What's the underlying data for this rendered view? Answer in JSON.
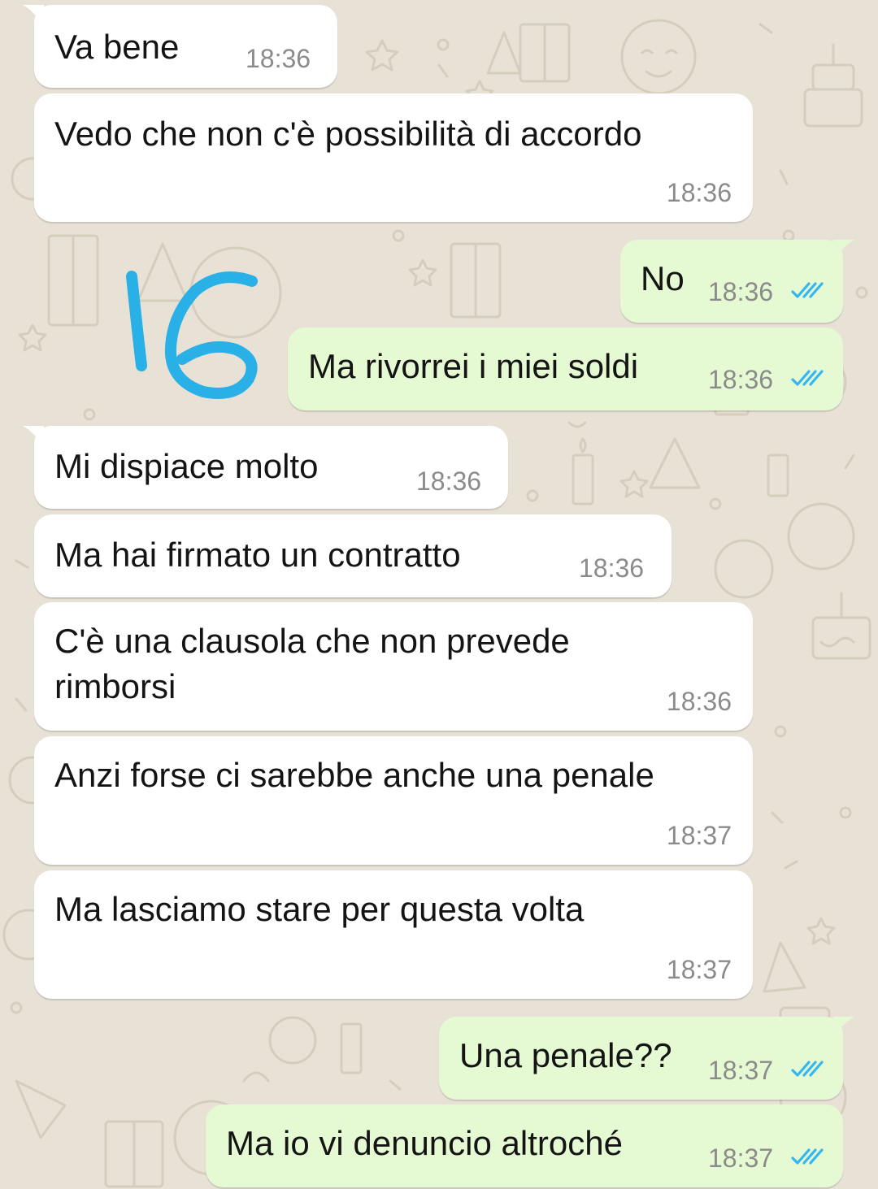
{
  "colors": {
    "wallpaper": "#e8e1d6",
    "incoming_bubble": "#ffffff",
    "outgoing_bubble": "#e5f9d3",
    "read_ticks": "#34b7f1",
    "annotation_ink": "#29b0e6"
  },
  "annotation": {
    "text": "16"
  },
  "messages": [
    {
      "direction": "incoming",
      "text": "Va bene",
      "time": "18:36"
    },
    {
      "direction": "incoming",
      "text": "Vedo che non c'è possibilità di accordo",
      "time": "18:36"
    },
    {
      "direction": "outgoing",
      "text": "No",
      "time": "18:36",
      "status": "read",
      "status_icon": "double-check-icon"
    },
    {
      "direction": "outgoing",
      "text": "Ma rivorrei i miei soldi",
      "time": "18:36",
      "status": "read",
      "status_icon": "double-check-icon"
    },
    {
      "direction": "incoming",
      "text": "Mi dispiace molto",
      "time": "18:36"
    },
    {
      "direction": "incoming",
      "text": "Ma hai firmato un contratto",
      "time": "18:36"
    },
    {
      "direction": "incoming",
      "text_lines": [
        "C'è una clausola che non prevede",
        "rimborsi"
      ],
      "time": "18:36"
    },
    {
      "direction": "incoming",
      "text": "Anzi forse ci sarebbe anche una penale",
      "time": "18:37"
    },
    {
      "direction": "incoming",
      "text": "Ma lasciamo stare per questa volta",
      "time": "18:37"
    },
    {
      "direction": "outgoing",
      "text": "Una penale??",
      "time": "18:37",
      "status": "read",
      "status_icon": "double-check-icon"
    },
    {
      "direction": "outgoing",
      "text": "Ma io vi denuncio altroché",
      "time": "18:37",
      "status": "read",
      "status_icon": "double-check-icon"
    }
  ]
}
